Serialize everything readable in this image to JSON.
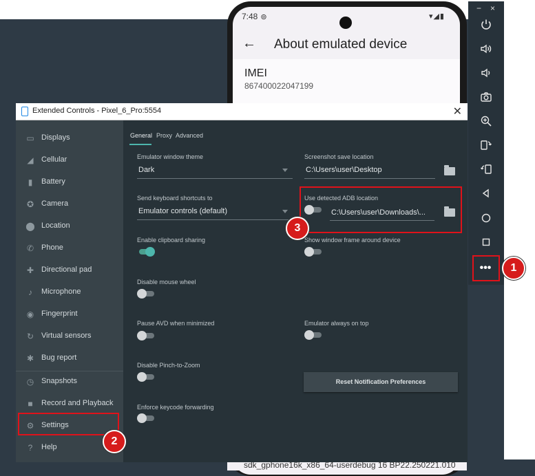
{
  "phone": {
    "status_time": "7:48",
    "status_icons": "▾◢▮",
    "screen_title": "About emulated device",
    "imei_label": "IMEI",
    "imei_value": "867400022047199",
    "build_text": "sdk_gphone16k_x86_64-userdebug 16 BP22.250221.010"
  },
  "toolbar": {
    "minimize": "−",
    "close": "×",
    "more": "•••",
    "icons": [
      "power-icon",
      "volume-up-icon",
      "volume-down-icon",
      "camera-icon",
      "zoom-icon",
      "rotate-left-icon",
      "rotate-right-icon",
      "back-icon",
      "home-icon",
      "overview-icon"
    ]
  },
  "window": {
    "title": "Extended Controls - Pixel_6_Pro:5554",
    "close": "✕"
  },
  "sidebar": {
    "items": [
      {
        "label": "Displays",
        "icon": "▭"
      },
      {
        "label": "Cellular",
        "icon": "◢"
      },
      {
        "label": "Battery",
        "icon": "▮"
      },
      {
        "label": "Camera",
        "icon": "✪"
      },
      {
        "label": "Location",
        "icon": "⬤"
      },
      {
        "label": "Phone",
        "icon": "✆"
      },
      {
        "label": "Directional pad",
        "icon": "✚"
      },
      {
        "label": "Microphone",
        "icon": "♪"
      },
      {
        "label": "Fingerprint",
        "icon": "◉"
      },
      {
        "label": "Virtual sensors",
        "icon": "↻"
      },
      {
        "label": "Bug report",
        "icon": "✱"
      },
      {
        "label": "Snapshots",
        "icon": "◷"
      },
      {
        "label": "Record and Playback",
        "icon": "■"
      },
      {
        "label": "Settings",
        "icon": "⚙"
      },
      {
        "label": "Help",
        "icon": "?"
      }
    ]
  },
  "tabs": [
    {
      "label": "General"
    },
    {
      "label": "Proxy"
    },
    {
      "label": "Advanced"
    }
  ],
  "settings": {
    "theme_label": "Emulator window theme",
    "theme_value": "Dark",
    "shortcuts_label": "Send keyboard shortcuts to",
    "shortcuts_value": "Emulator controls (default)",
    "clipboard_label": "Enable clipboard sharing",
    "mouse_wheel_label": "Disable mouse wheel",
    "pause_avd_label": "Pause AVD when minimized",
    "pinch_label": "Disable Pinch-to-Zoom",
    "keycode_label": "Enforce keycode forwarding",
    "screenshot_label": "Screenshot save location",
    "screenshot_value": "C:\\Users\\user\\Desktop",
    "adb_label": "Use detected ADB location",
    "adb_value": "C:\\Users\\user\\Downloads\\...",
    "frame_label": "Show window frame around device",
    "ontop_label": "Emulator always on top",
    "reset_button": "Reset Notification Preferences"
  },
  "badges": {
    "one": "1",
    "two": "2",
    "three": "3"
  },
  "colors": {
    "accent": "#4db6ac",
    "highlight": "#e0121a",
    "badge": "#d61c1c"
  }
}
